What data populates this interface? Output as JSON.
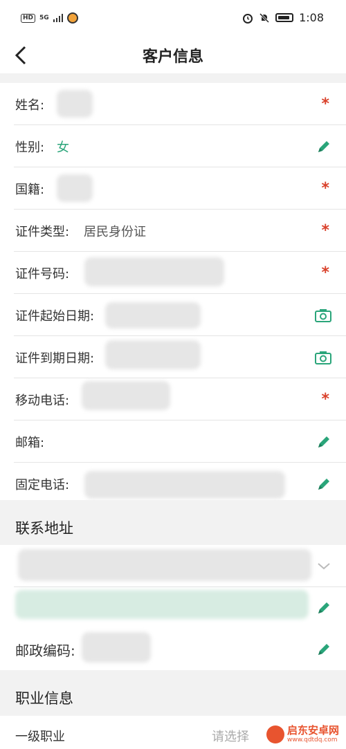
{
  "status_bar": {
    "left_badge": "HD",
    "signal": "5G",
    "time": "1:08"
  },
  "nav": {
    "title": "客户信息"
  },
  "fields": [
    {
      "label": "姓名:",
      "value": "",
      "indicator": "*"
    },
    {
      "label": "性别:",
      "value": "女",
      "indicator": "pencil-icon"
    },
    {
      "label": "国籍:",
      "value": "",
      "indicator": "*"
    },
    {
      "label": "证件类型:",
      "value": "居民身份证",
      "indicator": "*"
    },
    {
      "label": "证件号码:",
      "value": "",
      "indicator": "*"
    },
    {
      "label": "证件起始日期:",
      "value": "",
      "indicator": "camera-icon"
    },
    {
      "label": "证件到期日期:",
      "value": "",
      "indicator": "camera-icon"
    },
    {
      "label": "移动电话:",
      "value": "",
      "indicator": "*"
    },
    {
      "label": "邮箱:",
      "value": "",
      "indicator": "pencil-icon"
    },
    {
      "label": "固定电话:",
      "value": "",
      "indicator": "pencil-icon"
    }
  ],
  "address_section": {
    "title": "联系地址",
    "postal_label": "邮政编码:"
  },
  "occupation_section": {
    "title": "职业信息",
    "first_label": "一级职业",
    "first_placeholder": "请选择"
  },
  "watermark": {
    "name": "启东安卓网",
    "url": "www.qdtdq.com"
  },
  "colors": {
    "accent": "#2aa57a",
    "required": "#d9412b",
    "section_bg": "#f2f2f2"
  }
}
